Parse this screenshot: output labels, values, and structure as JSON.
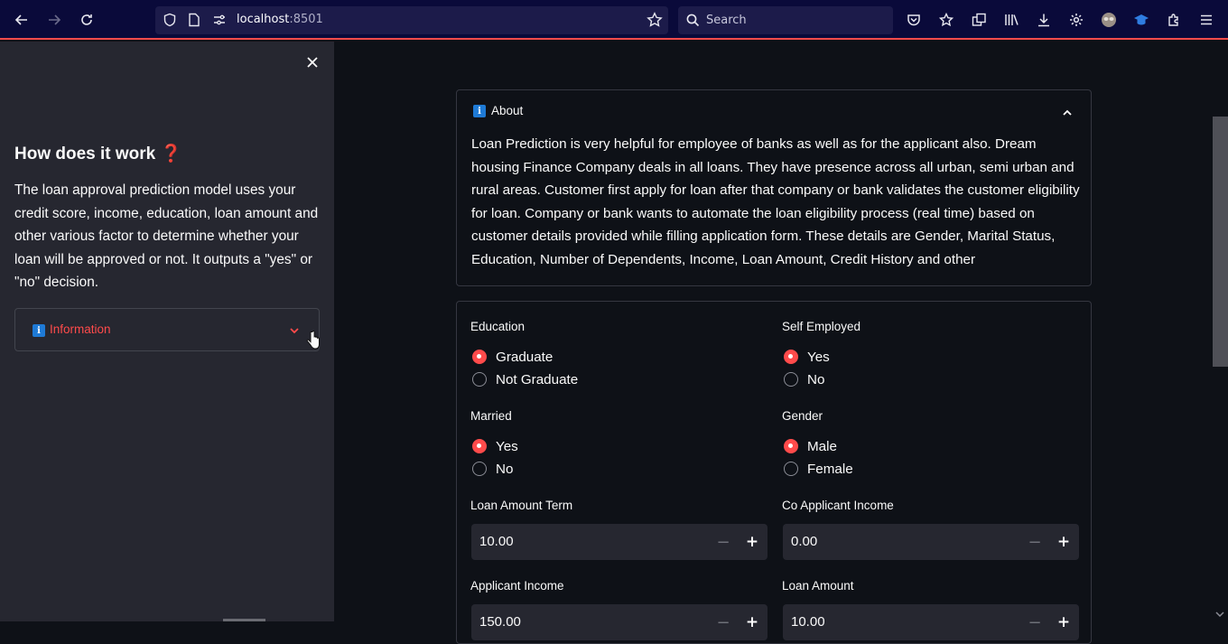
{
  "browser": {
    "url_host": "localhost",
    "url_port": ":8501",
    "search_placeholder": "Search"
  },
  "sidebar": {
    "title": "How does it work",
    "title_emoji": "❓",
    "description": "The loan approval prediction model uses your credit score, income, education, loan amount and other various factor to determine whether your loan will be approved or not. It outputs a \"yes\" or \"no\" decision.",
    "expander_label": "Information",
    "expander_icon": "info-icon"
  },
  "about": {
    "label": "About",
    "text": "Loan Prediction is very helpful for employee of banks as well as for the applicant also. Dream housing Finance Company deals in all loans. They have presence across all urban, semi urban and rural areas. Customer first apply for loan after that company or bank validates the customer eligibility for loan. Company or bank wants to automate the loan eligibility process (real time) based on customer details provided while filling application form. These details are Gender, Marital Status, Education, Number of Dependents, Income, Loan Amount, Credit History and other"
  },
  "form": {
    "education": {
      "label": "Education",
      "options": [
        "Graduate",
        "Not Graduate"
      ],
      "selected": "Graduate"
    },
    "self_employed": {
      "label": "Self Employed",
      "options": [
        "Yes",
        "No"
      ],
      "selected": "Yes"
    },
    "married": {
      "label": "Married",
      "options": [
        "Yes",
        "No"
      ],
      "selected": "Yes"
    },
    "gender": {
      "label": "Gender",
      "options": [
        "Male",
        "Female"
      ],
      "selected": "Male"
    },
    "loan_amount_term": {
      "label": "Loan Amount Term",
      "value": "10.00"
    },
    "co_applicant_income": {
      "label": "Co Applicant Income",
      "value": "0.00"
    },
    "applicant_income": {
      "label": "Applicant Income",
      "value": "150.00"
    },
    "loan_amount": {
      "label": "Loan Amount",
      "value": "10.00"
    }
  },
  "colors": {
    "accent": "#ff4b4b",
    "background": "#0e1117",
    "sidebar_bg": "#262730",
    "browser_bg": "#0a0a3a"
  }
}
